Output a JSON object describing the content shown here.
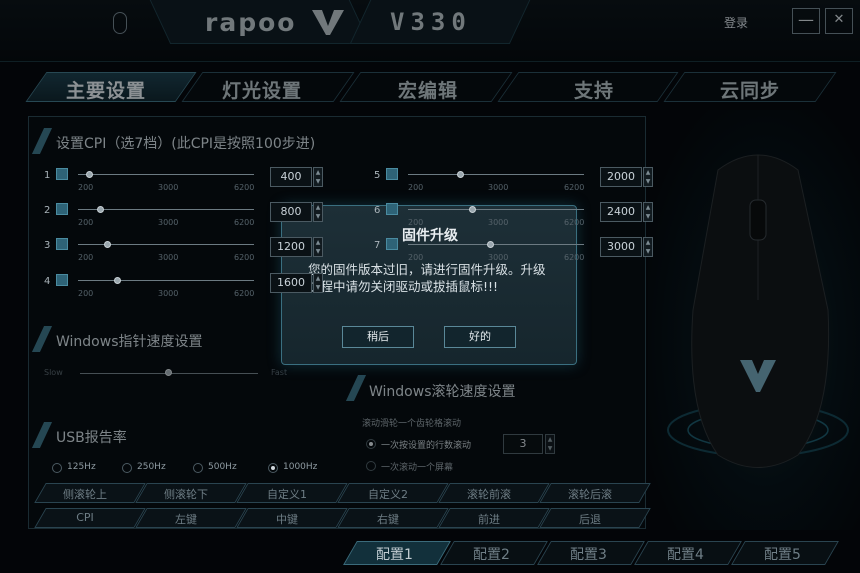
{
  "header": {
    "brand": "rapoo",
    "model": "V330",
    "login": "登录",
    "minimize": "—",
    "close": "✕"
  },
  "tabs": [
    {
      "label": "主要设置",
      "active": true
    },
    {
      "label": "灯光设置"
    },
    {
      "label": "宏编辑"
    },
    {
      "label": "支持"
    },
    {
      "label": "云同步"
    }
  ],
  "cpi": {
    "title": "设置CPI（选7档）(此CPI是按照100步进)",
    "scale": [
      "200",
      "3000",
      "6200"
    ],
    "rows": [
      {
        "num": "1",
        "value": "400"
      },
      {
        "num": "2",
        "value": "800"
      },
      {
        "num": "3",
        "value": "1200"
      },
      {
        "num": "4",
        "value": "1600"
      },
      {
        "num": "5",
        "value": "2000"
      },
      {
        "num": "6",
        "value": "2400"
      },
      {
        "num": "7",
        "value": "3000"
      }
    ],
    "knob_fraction": [
      0.07,
      0.13,
      0.17,
      0.23,
      0.3,
      0.37,
      0.47
    ]
  },
  "pointer": {
    "title": "Windows指针速度设置",
    "slow": "Slow",
    "fast": "Fast",
    "level": 0.5
  },
  "scroll": {
    "title": "Windows滚轮速度设置",
    "subtitle": "滚动滑轮一个齿轮格滚动",
    "opt1": "一次按设置的行数滚动",
    "opt1_value": "3",
    "opt2": "一次滚动一个屏幕"
  },
  "usb": {
    "title": "USB报告率",
    "rates": [
      "125Hz",
      "250Hz",
      "500Hz",
      "1000Hz"
    ],
    "selected": "1000Hz"
  },
  "buttons_row1": [
    "侧滚轮上",
    "侧滚轮下",
    "自定义1",
    "自定义2",
    "滚轮前滚",
    "滚轮后滚"
  ],
  "buttons_row2": [
    "CPI",
    "左键",
    "中键",
    "右键",
    "前进",
    "后退"
  ],
  "configs": [
    "配置1",
    "配置2",
    "配置3",
    "配置4",
    "配置5"
  ],
  "dialog": {
    "title": "固件升级",
    "message": "您的固件版本过旧，请进行固件升级。升级过程中请勿关闭驱动或拔插鼠标!!!",
    "later": "稍后",
    "ok": "好的"
  },
  "colors": {
    "accent": "#3a6f80",
    "dialog_bg": "#1a2b33"
  }
}
